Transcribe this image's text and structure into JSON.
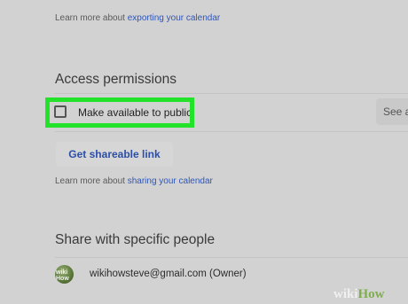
{
  "export": {
    "prefix": "Learn more about ",
    "link": "exporting your calendar"
  },
  "access": {
    "title": "Access permissions",
    "public_label": "Make available to public",
    "public_checked": false,
    "see_all_label": "See a",
    "shareable_link_button": "Get shareable link",
    "learn_prefix": "Learn more about ",
    "learn_link": "sharing your calendar"
  },
  "share": {
    "title": "Share with specific people",
    "owner_email": "wikihowsteve@gmail.com (Owner)",
    "avatar_text": "wiki How"
  },
  "watermark": {
    "wiki": "wiki",
    "how": "How"
  },
  "colors": {
    "highlight": "#22e32a",
    "link": "#2f55b8",
    "background": "#d2d2d2"
  }
}
